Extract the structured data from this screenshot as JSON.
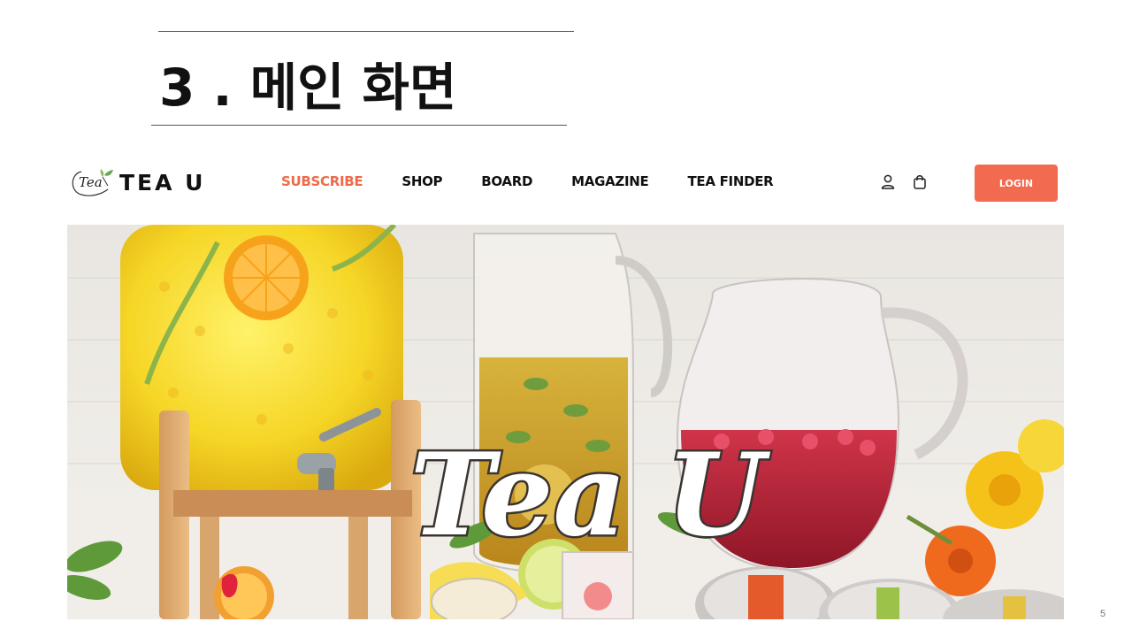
{
  "slide": {
    "title": "3 . 메인 화면",
    "page_number": "5"
  },
  "site": {
    "logo_script": "Tea",
    "logo_text": "TEA U",
    "nav": [
      {
        "label": "SUBSCRIBE",
        "active": true
      },
      {
        "label": "SHOP",
        "active": false
      },
      {
        "label": "BOARD",
        "active": false
      },
      {
        "label": "MAGAZINE",
        "active": false
      },
      {
        "label": "TEA FINDER",
        "active": false
      }
    ],
    "icons": [
      "user-icon",
      "shopping-bag-icon"
    ],
    "login_label": "LOGIN",
    "accent_color": "#f26a4f"
  },
  "hero": {
    "overlay_text": "Tea U"
  }
}
